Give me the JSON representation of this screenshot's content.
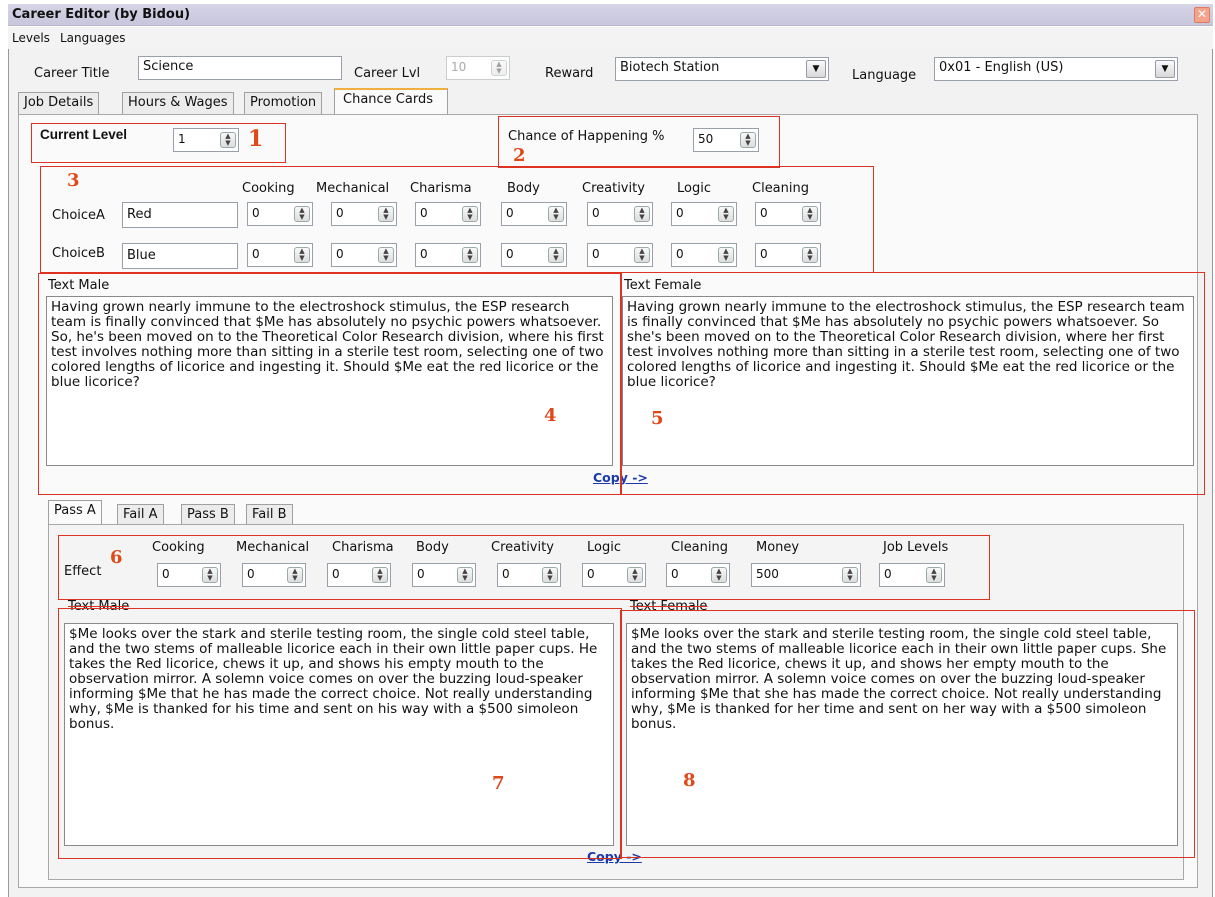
{
  "app": {
    "title": "Career Editor (by Bidou)"
  },
  "menu": {
    "items": [
      "Levels",
      "Languages"
    ]
  },
  "header": {
    "career_title_label": "Career Title",
    "career_title_value": "Science",
    "career_lvl_label": "Career Lvl",
    "career_lvl_value": "10",
    "reward_label": "Reward",
    "reward_value": "Biotech Station",
    "language_label": "Language",
    "language_value": "0x01 - English (US)"
  },
  "tabs": [
    "Job Details",
    "Hours & Wages",
    "Promotion",
    "Chance Cards"
  ],
  "active_tab": "Chance Cards",
  "current_level": {
    "label": "Current Level",
    "value": "1"
  },
  "chance": {
    "label": "Chance of Happening %",
    "value": "50"
  },
  "skills": [
    "Cooking",
    "Mechanical",
    "Charisma",
    "Body",
    "Creativity",
    "Logic",
    "Cleaning"
  ],
  "choices": [
    {
      "label": "ChoiceA",
      "name": "Red",
      "values": [
        "0",
        "0",
        "0",
        "0",
        "0",
        "0",
        "0"
      ]
    },
    {
      "label": "ChoiceB",
      "name": "Blue",
      "values": [
        "0",
        "0",
        "0",
        "0",
        "0",
        "0",
        "0"
      ]
    }
  ],
  "text_male_label": "Text Male",
  "text_female_label": "Text Female",
  "card_text_male": "Having grown nearly immune to the electroshock stimulus, the ESP research team is finally convinced that $Me has absolutely no psychic powers whatsoever. So, he's been moved on to the Theoretical Color Research division, where his first test involves nothing more than sitting in a sterile test room, selecting one of two colored lengths of licorice and ingesting it. Should $Me eat the red licorice or the blue licorice?",
  "card_text_female": "Having grown nearly immune to the electroshock stimulus, the ESP research team is finally convinced that $Me has absolutely no psychic powers whatsoever. So she's been moved on to the Theoretical Color Research division, where her first test involves nothing more than sitting in a sterile test room, selecting one of two colored lengths of licorice and ingesting it. Should $Me eat the red licorice or the blue licorice?",
  "copy_label": "Copy ->",
  "outcome_tabs": [
    "Pass A",
    "Fail A",
    "Pass B",
    "Fail B"
  ],
  "effect": {
    "label": "Effect",
    "columns": [
      "Cooking",
      "Mechanical",
      "Charisma",
      "Body",
      "Creativity",
      "Logic",
      "Cleaning",
      "Money",
      "Job Levels"
    ],
    "values": [
      "0",
      "0",
      "0",
      "0",
      "0",
      "0",
      "0",
      "500",
      "0"
    ]
  },
  "outcome_text_male": "$Me looks over the stark and sterile testing room, the single cold steel table, and the two stems of malleable licorice each in their own little paper cups. He takes the Red licorice, chews it up, and shows his empty mouth to the observation mirror. A solemn voice comes on over the buzzing loud-speaker informing $Me that he has made the correct choice. Not really understanding why, $Me is thanked for his time and sent on his way with a $500 simoleon bonus.",
  "outcome_text_female": "$Me looks over the stark and sterile testing room, the single cold steel table, and the two stems of malleable licorice each in their own little paper cups. She takes the Red licorice, chews it up, and shows her empty mouth to the observation mirror. A solemn voice comes on over the buzzing loud-speaker informing $Me that she has made the correct choice. Not really understanding why, $Me is thanked for her time and sent on her way with a $500 simoleon bonus.",
  "annotations": [
    "1",
    "2",
    "3",
    "4",
    "5",
    "6",
    "7",
    "8"
  ],
  "colors": {
    "annotation": "#dd3322",
    "link": "#1a3aaa",
    "tab_accent": "#f0b040"
  }
}
